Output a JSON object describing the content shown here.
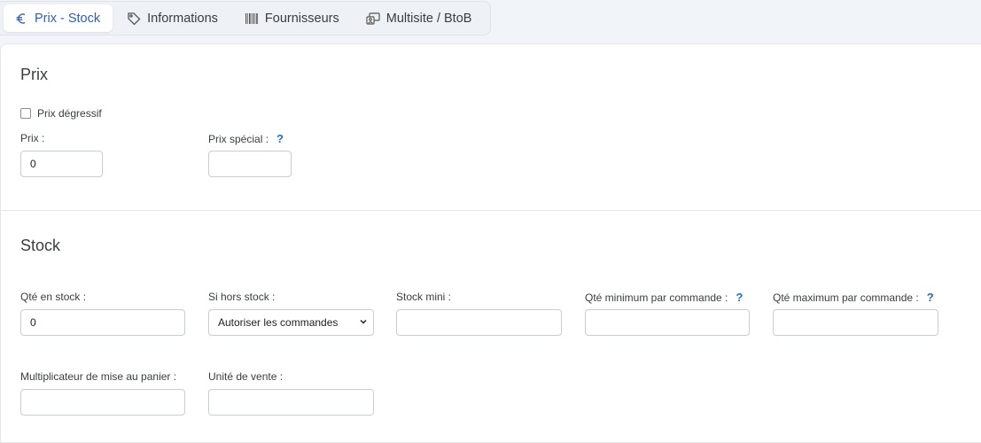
{
  "tabs": [
    {
      "label": "Prix - Stock",
      "icon": "euro-icon",
      "active": true
    },
    {
      "label": "Informations",
      "icon": "tag-icon",
      "active": false
    },
    {
      "label": "Fournisseurs",
      "icon": "barcode-icon",
      "active": false
    },
    {
      "label": "Multisite / BtoB",
      "icon": "multisite-icon",
      "active": false
    }
  ],
  "prix": {
    "title": "Prix",
    "degressif_label": "Prix dégressif",
    "degressif_checked": false,
    "prix_label": "Prix :",
    "prix_value": "0",
    "special_label": "Prix spécial :",
    "special_value": "",
    "help_glyph": "?"
  },
  "stock": {
    "title": "Stock",
    "qte_label": "Qté en stock :",
    "qte_value": "0",
    "hors_label": "Si hors stock :",
    "hors_value": "Autoriser les commandes",
    "mini_label": "Stock mini :",
    "mini_value": "",
    "min_cmd_label": "Qté minimum par commande :",
    "min_cmd_value": "",
    "max_cmd_label": "Qté maximum par commande :",
    "max_cmd_value": "",
    "multi_label": "Multiplicateur de mise au panier :",
    "multi_value": "",
    "unite_label": "Unité de vente :",
    "unite_value": "",
    "help_glyph": "?"
  },
  "colors": {
    "accent": "#2f5fb3",
    "help": "#1f6fc7"
  }
}
